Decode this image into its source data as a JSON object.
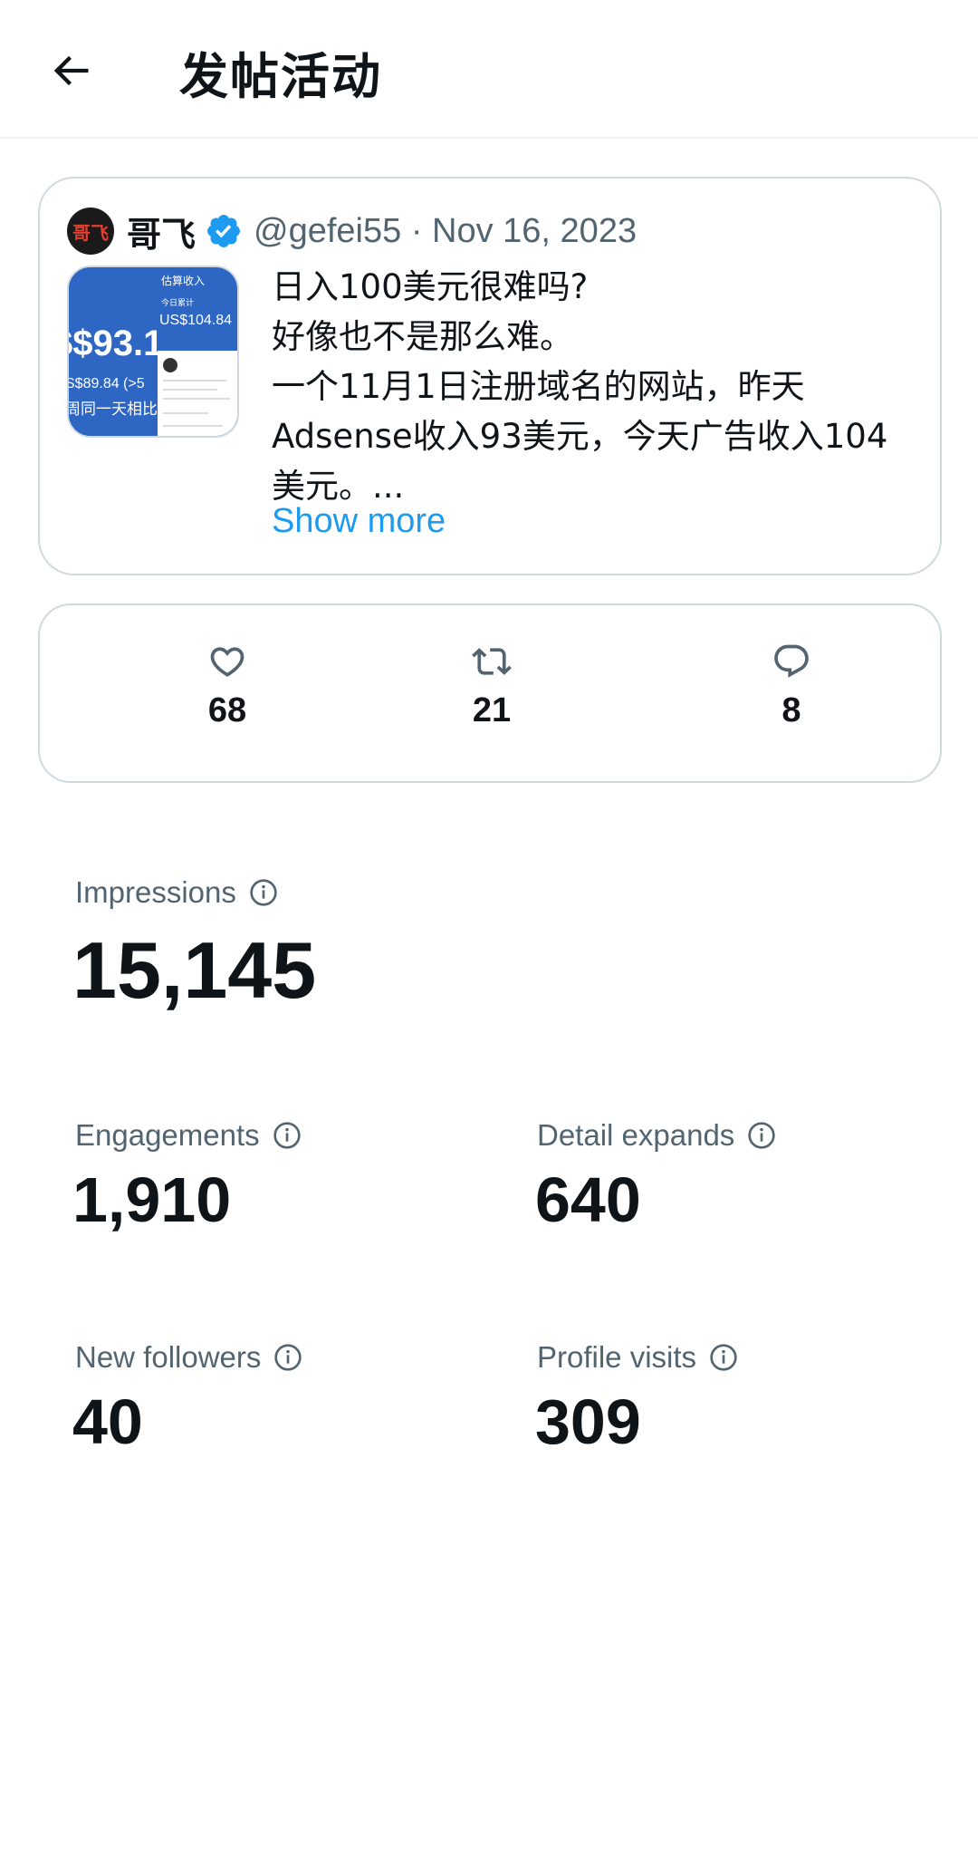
{
  "header": {
    "title": "发帖活动",
    "back_icon": "arrow-left-icon"
  },
  "post": {
    "avatar_text": "哥飞",
    "author_name": "哥飞",
    "verified_icon": "verified-badge-icon",
    "handle_date": "@gefei55 · Nov 16, 2023",
    "text": "日入100美元很难吗?\n好像也不是那么难。\n一个11月1日注册域名的网站，昨天\nAdsense收入93美元，今天广告收入104\n美元。...",
    "show_more": "Show more",
    "thumbnail": {
      "big_amount": "$$93.1",
      "small_line1": "S$89.84 (>5",
      "small_line2": "周同一天相比",
      "right_title": "估算收入",
      "right_sub": "今日累计",
      "right_amount": "US$104.84"
    }
  },
  "engagement": {
    "likes": "68",
    "reposts": "21",
    "replies": "8"
  },
  "metrics": {
    "impressions": {
      "label": "Impressions",
      "value": "15,145"
    },
    "engagements": {
      "label": "Engagements",
      "value": "1,910"
    },
    "detail_expands": {
      "label": "Detail expands",
      "value": "640"
    },
    "new_followers": {
      "label": "New followers",
      "value": "40"
    },
    "profile_visits": {
      "label": "Profile visits",
      "value": "309"
    }
  },
  "colors": {
    "accent": "#1d9bf0",
    "text_primary": "#0f1419",
    "text_secondary": "#536471",
    "border": "#cfd9de"
  }
}
